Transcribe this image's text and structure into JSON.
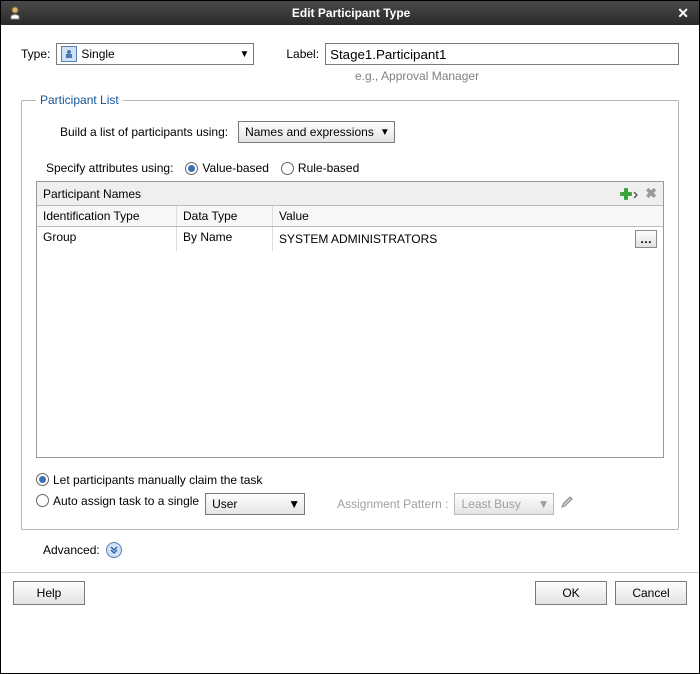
{
  "titlebar": {
    "title": "Edit Participant Type"
  },
  "top": {
    "type_label": "Type:",
    "type_value": "Single",
    "label_label": "Label:",
    "label_value": "Stage1.Participant1",
    "hint": "e.g., Approval Manager"
  },
  "participant_list": {
    "legend": "Participant List",
    "build_label": "Build a list of participants using:",
    "build_value": "Names and expressions",
    "specify_label": "Specify attributes using:",
    "value_based": "Value-based",
    "rule_based": "Rule-based",
    "table_title": "Participant Names",
    "columns": {
      "c1": "Identification Type",
      "c2": "Data Type",
      "c3": "Value"
    },
    "rows": [
      {
        "idtype": "Group",
        "datatype": "By Name",
        "value": "SYSTEM ADMINISTRATORS"
      }
    ],
    "claim_manual": "Let participants manually claim the task",
    "claim_auto_prefix": "Auto assign task to a single",
    "claim_auto_target": "User",
    "assignment_pattern_label": "Assignment Pattern :",
    "assignment_pattern_value": "Least Busy"
  },
  "advanced": {
    "label": "Advanced:"
  },
  "footer": {
    "help": "Help",
    "ok": "OK",
    "cancel": "Cancel"
  }
}
